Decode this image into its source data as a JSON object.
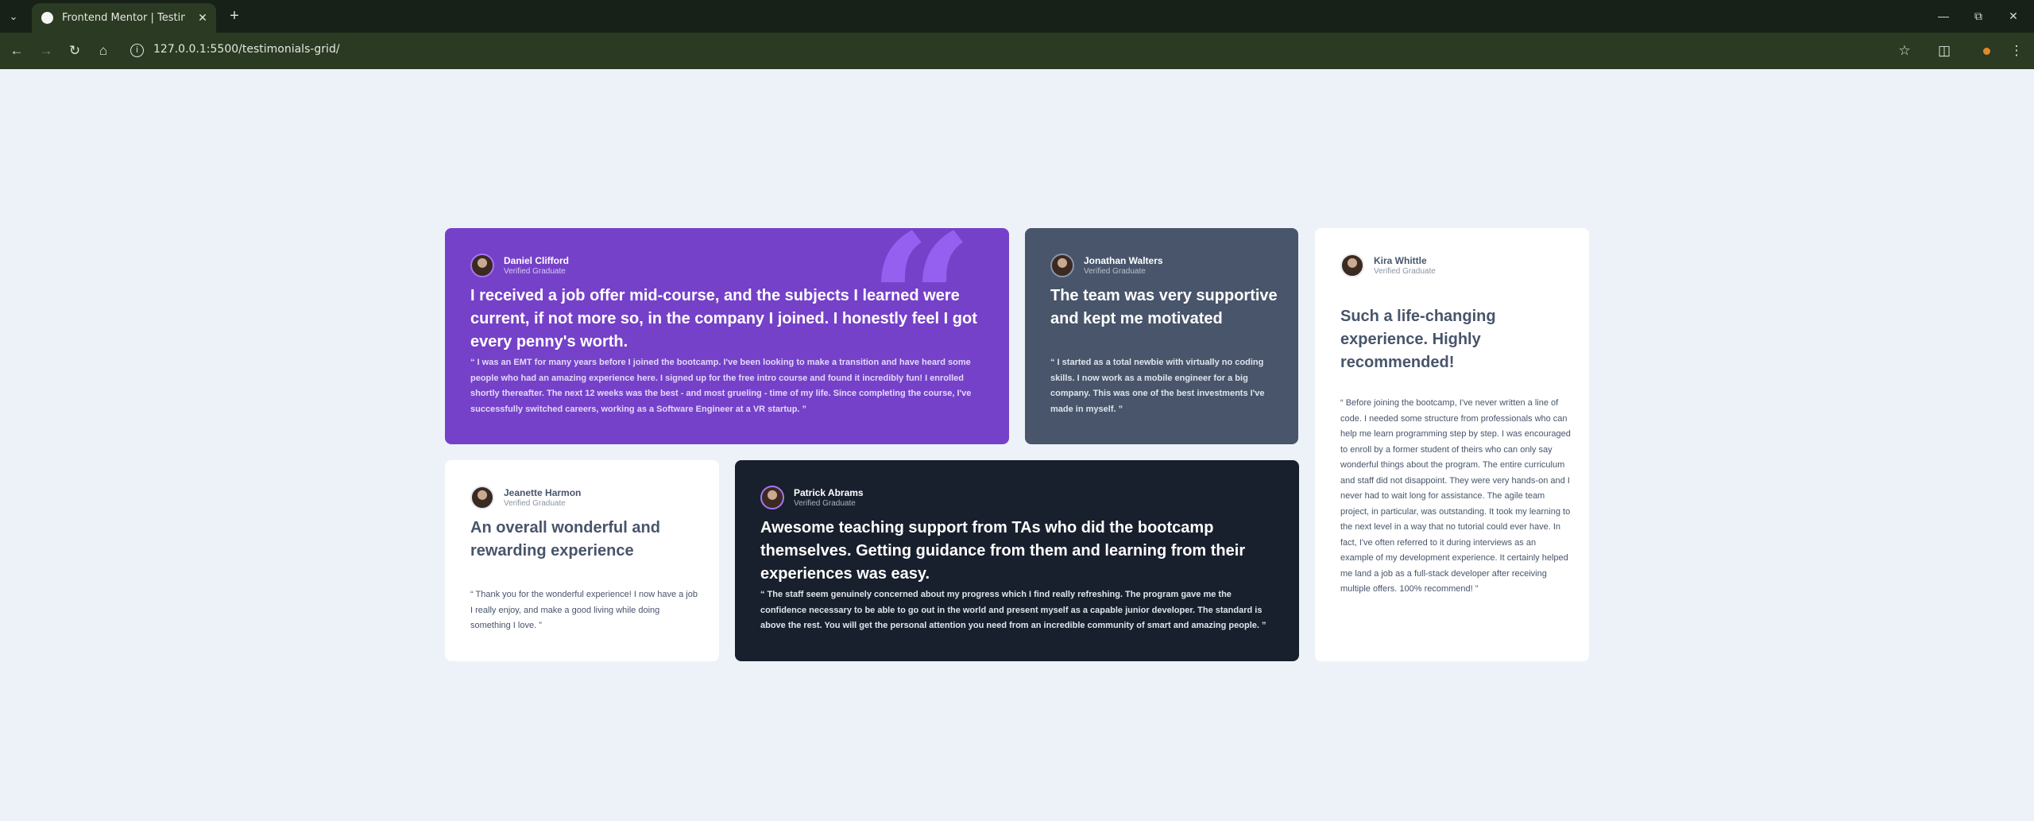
{
  "browser": {
    "tab_title": "Frontend Mentor | Testimonials",
    "url": "127.0.0.1:5500/testimonials-grid/"
  },
  "testimonials": {
    "daniel": {
      "name": "Daniel Clifford",
      "role": "Verified Graduate",
      "headline": "I received a job offer mid-course, and the subjects I learned were current, if not more so, in the company I joined. I honestly feel I got every penny's worth.",
      "quote": "“ I was an EMT for many years before I joined the bootcamp. I've been looking to make a transition and have heard some people who had an amazing experience here. I signed up for the free intro course and found it incredibly fun! I enrolled shortly thereafter. The next 12 weeks was the best - and most grueling - time of my life. Since completing the course, I've successfully switched careers, working as a Software Engineer at a VR startup. ”"
    },
    "jonathan": {
      "name": "Jonathan Walters",
      "role": "Verified Graduate",
      "headline": "The team was very supportive and kept me motivated",
      "quote": "“ I started as a total newbie with virtually no coding skills. I now work as a mobile engineer for a big company. This was one of the best investments I've made in myself. ”"
    },
    "kira": {
      "name": "Kira Whittle",
      "role": "Verified Graduate",
      "headline": "Such a life-changing experience. Highly recommended!",
      "quote": "“ Before joining the bootcamp, I've never written a line of code. I needed some structure from professionals who can help me learn programming step by step. I was encouraged to enroll by a former student of theirs who can only say wonderful things about the program. The entire curriculum and staff did not disappoint. They were very hands-on and I never had to wait long for assistance. The agile team project, in particular, was outstanding. It took my learning to the next level in a way that no tutorial could ever have. In fact, I've often referred to it during interviews as an example of my development experience. It certainly helped me land a job as a full-stack developer after receiving multiple offers. 100% recommend! ”"
    },
    "jeanette": {
      "name": "Jeanette Harmon",
      "role": "Verified Graduate",
      "headline": "An overall wonderful and rewarding experience",
      "quote": "“ Thank you for the wonderful experience! I now have a job I really enjoy, and make a good living while doing something I love. ”"
    },
    "patrick": {
      "name": "Patrick Abrams",
      "role": "Verified Graduate",
      "headline": "Awesome teaching support from TAs who did the bootcamp themselves. Getting guidance from them and learning from their experiences was easy.",
      "quote": "“ The staff seem genuinely concerned about my progress which I find really refreshing. The program gave me the confidence necessary to be able to go out in the world and present myself as a capable junior developer. The standard is above the rest. You will get the personal attention you need from an incredible community of smart and amazing people. ”"
    }
  }
}
